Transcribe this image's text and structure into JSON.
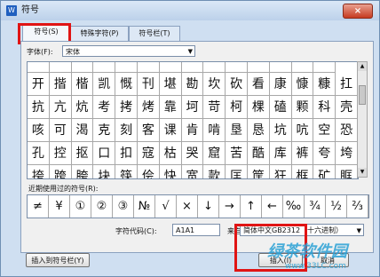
{
  "window": {
    "title": "符号",
    "app_icon_letter": "W",
    "close_glyph": "×"
  },
  "tabs": [
    {
      "label": "符号(S)",
      "active": true
    },
    {
      "label": "特殊字符(P)",
      "active": false
    },
    {
      "label": "符号栏(T)",
      "active": false
    }
  ],
  "font": {
    "label": "字体(F):",
    "value": "宋体"
  },
  "symbol_grid": {
    "rows": [
      [
        "一",
        "T",
        "厂",
        "木",
        "朩",
        "仁",
        "丁",
        "一",
        "一",
        "二",
        "口",
        "二",
        "二",
        "二"
      ],
      [
        "开",
        "揩",
        "楷",
        "凯",
        "慨",
        "刊",
        "堪",
        "勘",
        "坎",
        "砍",
        "看",
        "康",
        "慷",
        "糠",
        "扛"
      ],
      [
        "抗",
        "亢",
        "炕",
        "考",
        "拷",
        "烤",
        "靠",
        "坷",
        "苛",
        "柯",
        "棵",
        "磕",
        "颗",
        "科",
        "壳"
      ],
      [
        "咳",
        "可",
        "渴",
        "克",
        "刻",
        "客",
        "课",
        "肯",
        "啃",
        "垦",
        "恳",
        "坑",
        "吭",
        "空",
        "恐"
      ],
      [
        "孔",
        "控",
        "抠",
        "口",
        "扣",
        "寇",
        "枯",
        "哭",
        "窟",
        "苦",
        "酷",
        "库",
        "裤",
        "夸",
        "垮"
      ],
      [
        "挎",
        "跨",
        "胯",
        "块",
        "筷",
        "侩",
        "快",
        "宽",
        "款",
        "匡",
        "筐",
        "狂",
        "框",
        "矿",
        "眶"
      ]
    ]
  },
  "recent": {
    "label": "近期使用过的符号(R):",
    "symbols": [
      "≠",
      "¥",
      "①",
      "②",
      "③",
      "№",
      "√",
      "×",
      "↓",
      "→",
      "↑",
      "←",
      "‰",
      "¾",
      "½",
      "⅔"
    ]
  },
  "code": {
    "label": "字符代码(C):",
    "value": "A1A1",
    "from_label": "来自(M)",
    "from_value": "简体中文GB2312（十六进制）"
  },
  "buttons": {
    "insert_to_bar": "插入到符号栏(Y)",
    "insert": "插入(I)",
    "cancel": "取消"
  },
  "watermark": {
    "logo_text": "绿茶软件园",
    "url": "www.33LC.com"
  },
  "colors": {
    "highlight": "#e01414",
    "titlebar": "#bcd1ea",
    "close_button": "#c63a20",
    "watermark": "#2da2d6"
  }
}
